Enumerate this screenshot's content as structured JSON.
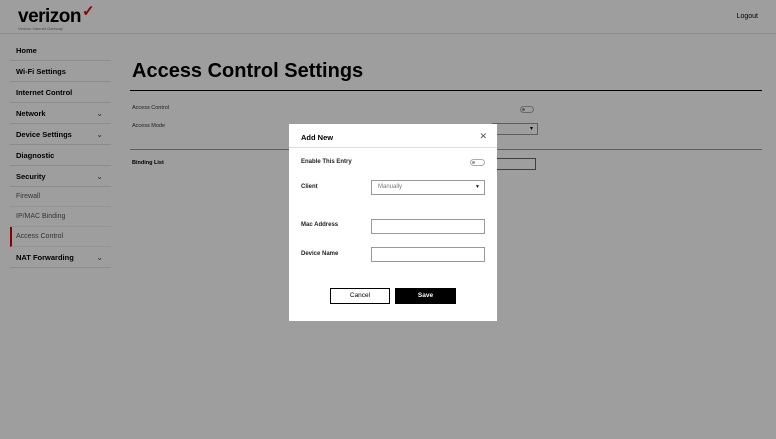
{
  "header": {
    "logo_text": "verizon",
    "logo_subtext": "Verizon Internet Gateway",
    "logout_label": "Logout"
  },
  "sidebar": {
    "items": [
      {
        "label": "Home"
      },
      {
        "label": "Wi-Fi Settings"
      },
      {
        "label": "Internet Control"
      },
      {
        "label": "Network",
        "chevron": "chevron-down-icon"
      },
      {
        "label": "Device Settings",
        "chevron": "chevron-down-icon"
      },
      {
        "label": "Diagnostic"
      },
      {
        "label": "Security",
        "chevron": "chevron-down-icon"
      }
    ],
    "security_sub": [
      {
        "label": "Firewall"
      },
      {
        "label": "IP/MAC Binding"
      },
      {
        "label": "Access Control",
        "active": true
      }
    ],
    "nat_forwarding": {
      "label": "NAT Forwarding",
      "chevron": "chevron-down-icon"
    }
  },
  "main": {
    "title": "Access Control Settings",
    "access_control_label": "Access Control",
    "access_mode_label": "Access Mode",
    "binding_list_label": "Binding List"
  },
  "modal": {
    "title": "Add New",
    "close_icon": "close-icon",
    "enable_label": "Enable This Entry",
    "client_label": "Client",
    "client_value": "Manually",
    "mac_label": "Mac Address",
    "mac_value": "",
    "device_label": "Device Name",
    "device_value": "",
    "cancel_label": "Cancel",
    "save_label": "Save"
  },
  "colors": {
    "accent": "#cc0000",
    "overlay": "rgba(0,0,0,0.38)",
    "primary_button": "#000000"
  }
}
